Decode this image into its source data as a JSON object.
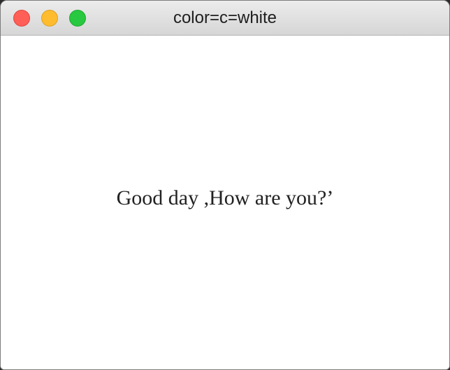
{
  "window": {
    "title": "color=c=white",
    "controls": {
      "close": "close-icon",
      "minimize": "minimize-icon",
      "zoom": "zoom-icon"
    }
  },
  "content": {
    "message": "Good day ,How are you?’",
    "background_color": "#ffffff",
    "text_color": "#222222"
  },
  "colors": {
    "close": "#ff5f57",
    "minimize": "#febc2e",
    "zoom": "#28c840"
  }
}
